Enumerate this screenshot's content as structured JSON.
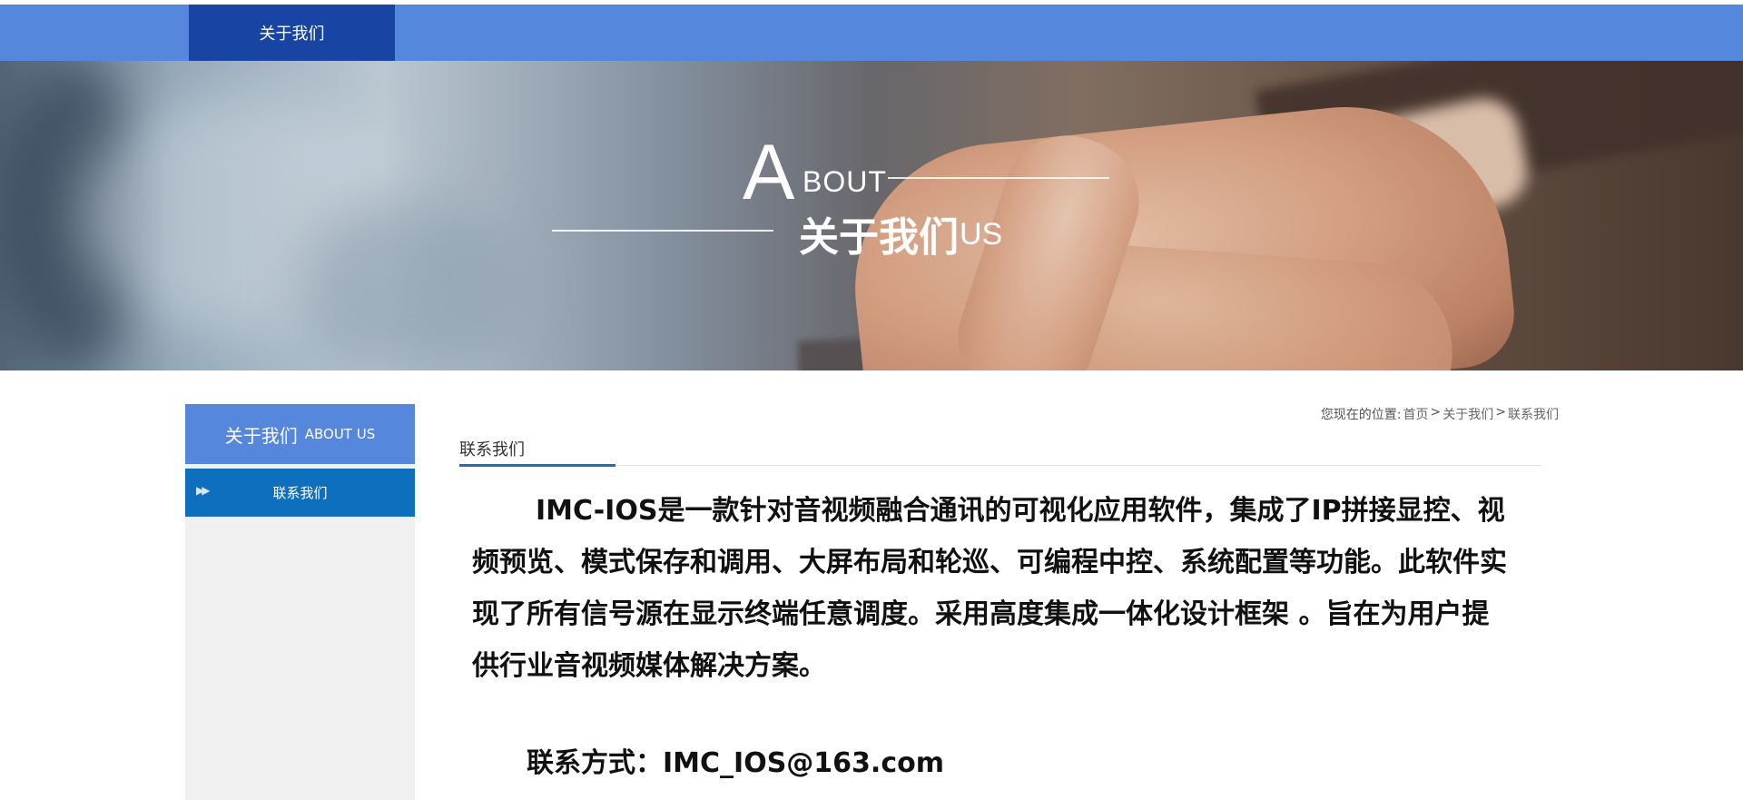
{
  "nav": {
    "items": [
      {
        "label": "关于我们",
        "active": true
      }
    ],
    "bar_color": "#5587dd",
    "active_color": "#1844a3"
  },
  "banner": {
    "big_letter": "A",
    "bout": "BOUT",
    "title_cn": "关于我们",
    "us": "US"
  },
  "sidebar": {
    "heading_cn": "关于我们",
    "heading_en": "ABOUT US",
    "items": [
      {
        "label": "联系我们",
        "active": true,
        "icon": "double-chevron-right-icon"
      }
    ],
    "accent": "#0e6fbf"
  },
  "breadcrumb": {
    "prefix": "您现在的位置:",
    "items": [
      "首页",
      "关于我们",
      "联系我们"
    ],
    "separator": ">"
  },
  "content": {
    "section_title": "联系我们",
    "paragraph": "IMC-IOS是一款针对音视频融合通讯的可视化应用软件，集成了IP拼接显控、视频预览、模式保存和调用、大屏布局和轮巡、可编程中控、系统配置等功能。此软件实现了所有信号源在显示终端任意调度。采用高度集成一体化设计框架 。旨在为用户提供行业音视频媒体解决方案。",
    "contact": "联系方式：IMC_IOS@163.com"
  }
}
